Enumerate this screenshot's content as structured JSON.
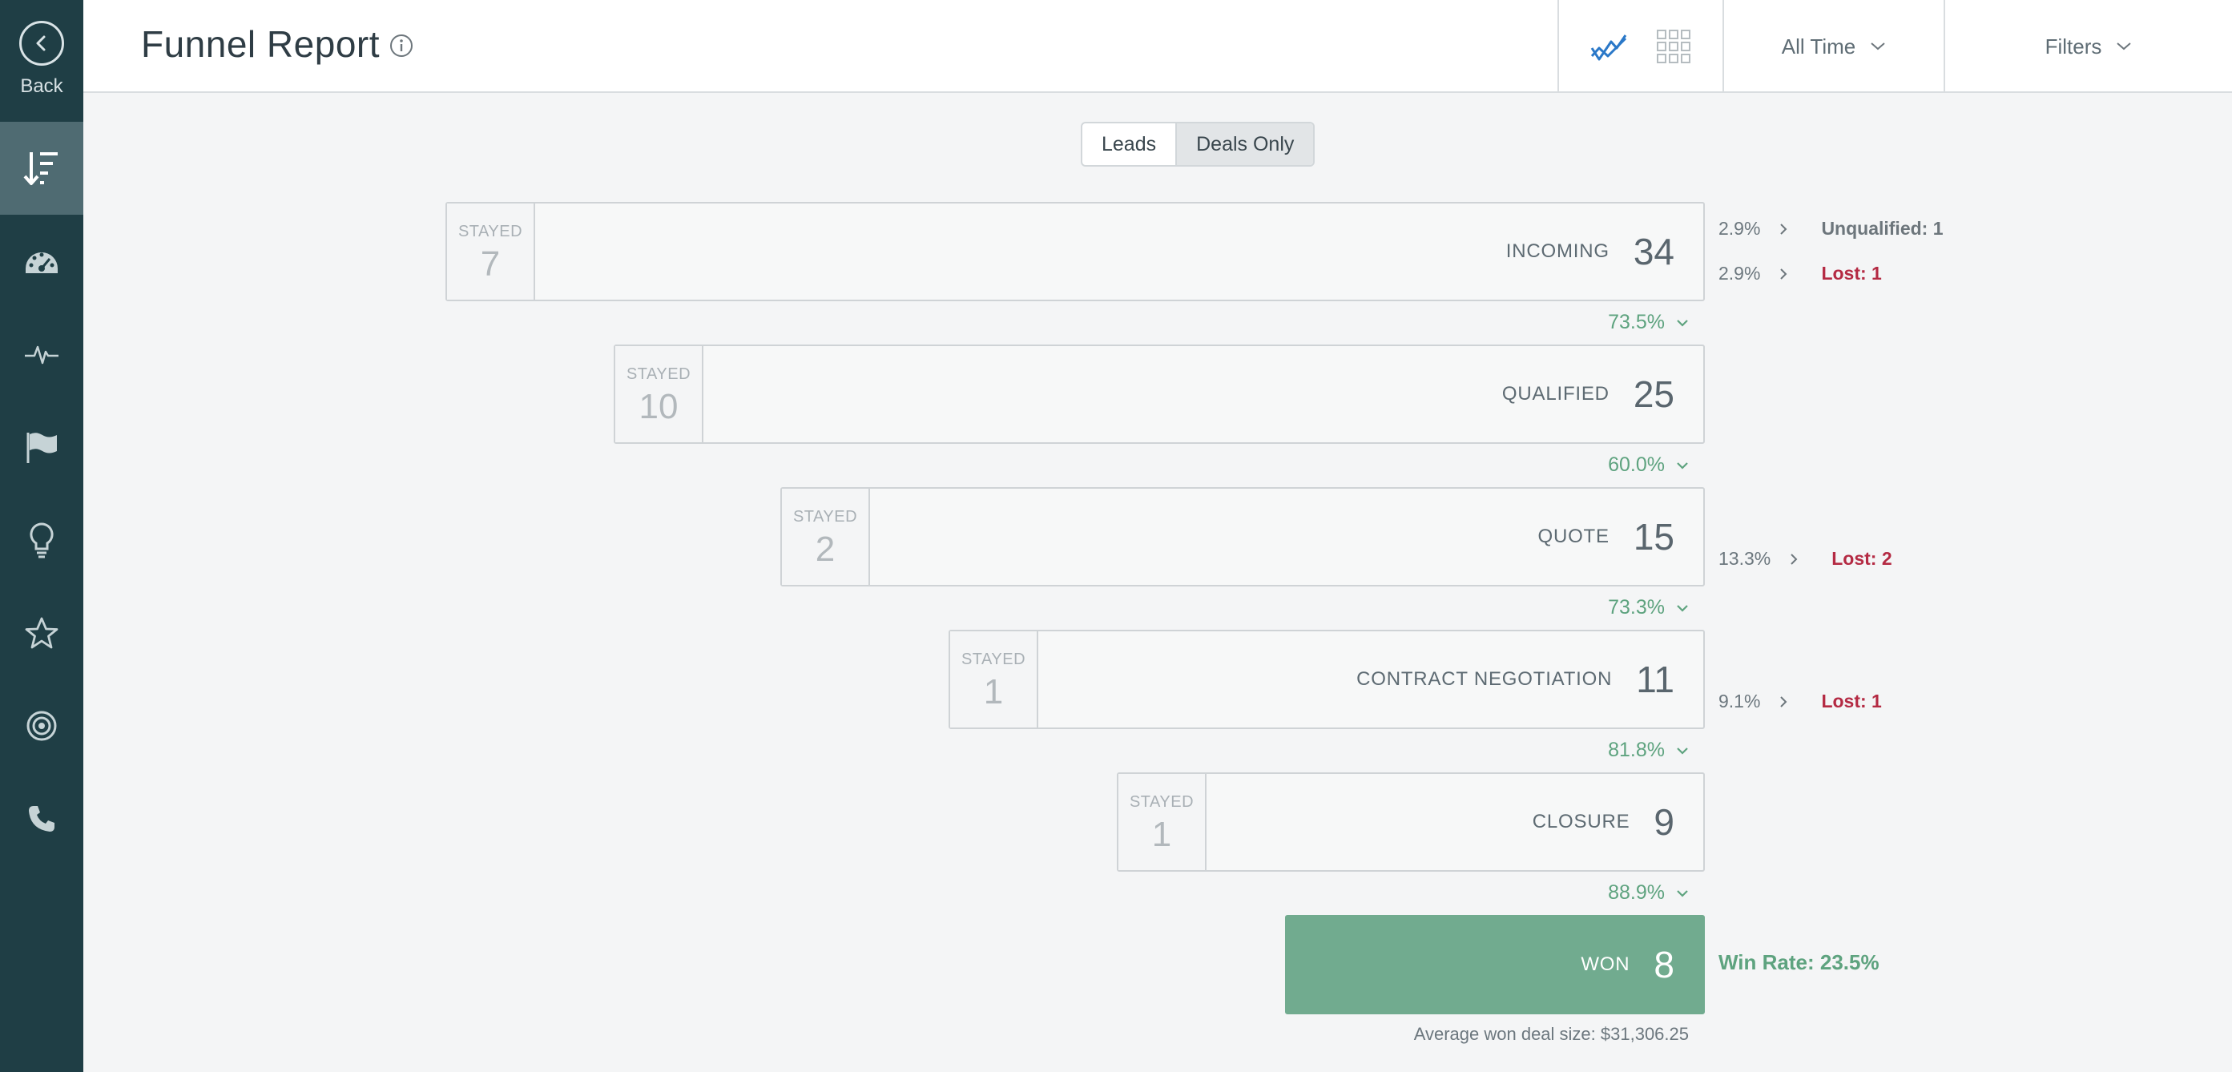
{
  "sidebar": {
    "back_label": "Back",
    "items": [
      {
        "icon": "funnel-sort-icon",
        "active": true
      },
      {
        "icon": "dashboard-gauge-icon"
      },
      {
        "icon": "activity-pulse-icon"
      },
      {
        "icon": "flag-icon"
      },
      {
        "icon": "lightbulb-icon"
      },
      {
        "icon": "star-icon"
      },
      {
        "icon": "target-icon"
      },
      {
        "icon": "phone-icon"
      }
    ]
  },
  "header": {
    "title": "Funnel Report",
    "date_range": "All Time",
    "filters": "Filters"
  },
  "toggle": {
    "leads": "Leads",
    "deals_only": "Deals Only",
    "selected": "Deals Only"
  },
  "stages": [
    {
      "name": "INCOMING",
      "count": "34",
      "stayed_label": "STAYED",
      "stayed": "7"
    },
    {
      "name": "QUALIFIED",
      "count": "25",
      "stayed_label": "STAYED",
      "stayed": "10"
    },
    {
      "name": "QUOTE",
      "count": "15",
      "stayed_label": "STAYED",
      "stayed": "2"
    },
    {
      "name": "CONTRACT NEGOTIATION",
      "count": "11",
      "stayed_label": "STAYED",
      "stayed": "1"
    },
    {
      "name": "CLOSURE",
      "count": "9",
      "stayed_label": "STAYED",
      "stayed": "1"
    },
    {
      "name": "WON",
      "count": "8"
    }
  ],
  "conversions": [
    "73.5%",
    "60.0%",
    "73.3%",
    "81.8%",
    "88.9%"
  ],
  "side_stats": {
    "incoming_unqualified": {
      "pct": "2.9%",
      "label": "Unqualified: 1"
    },
    "incoming_lost": {
      "pct": "2.9%",
      "label": "Lost: 1"
    },
    "quote_lost": {
      "pct": "13.3%",
      "label": "Lost: 2"
    },
    "contract_lost": {
      "pct": "9.1%",
      "label": "Lost: 1"
    }
  },
  "win_rate": "Win Rate: 23.5%",
  "avg_deal": "Average won deal size: $31,306.25",
  "colors": {
    "sidebar": "#1f3e45",
    "sidebar_active": "#4f6b72",
    "won": "#71ab8f",
    "conversion_green": "#5ea37f",
    "lost_red": "#b42a43"
  }
}
